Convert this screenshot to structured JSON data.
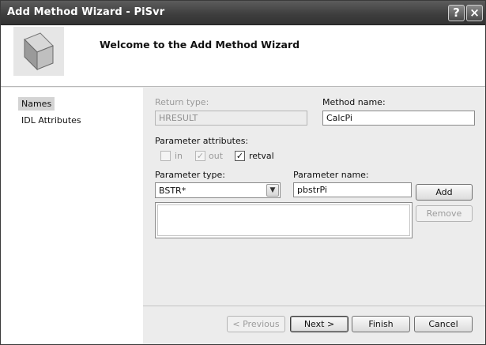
{
  "window": {
    "title": "Add Method Wizard - PiSvr"
  },
  "titlebar": {
    "help_label": "?",
    "close_label": "×"
  },
  "header": {
    "title": "Welcome to the Add Method Wizard"
  },
  "nav": {
    "items": [
      {
        "label": "Names"
      },
      {
        "label": "IDL Attributes"
      }
    ]
  },
  "form": {
    "return_type": {
      "label": "Return type:",
      "value": "HRESULT"
    },
    "method_name": {
      "label": "Method name:",
      "value": "CalcPi"
    },
    "parameter_attributes": {
      "label": "Parameter attributes:",
      "options": [
        {
          "label": "in",
          "checked": false,
          "enabled": false
        },
        {
          "label": "out",
          "checked": true,
          "enabled": false
        },
        {
          "label": "retval",
          "checked": true,
          "enabled": true
        }
      ]
    },
    "parameter_type": {
      "label": "Parameter type:",
      "value": "BSTR*"
    },
    "parameter_name": {
      "label": "Parameter name:",
      "value": "pbstrPi"
    },
    "add_label": "Add",
    "remove_label": "Remove"
  },
  "footer": {
    "previous_label": "< Previous",
    "next_label": "Next >",
    "finish_label": "Finish",
    "cancel_label": "Cancel"
  },
  "icons": {
    "header": "cube-icon",
    "dropdown": "chevron-down-icon",
    "check": "check-icon"
  }
}
